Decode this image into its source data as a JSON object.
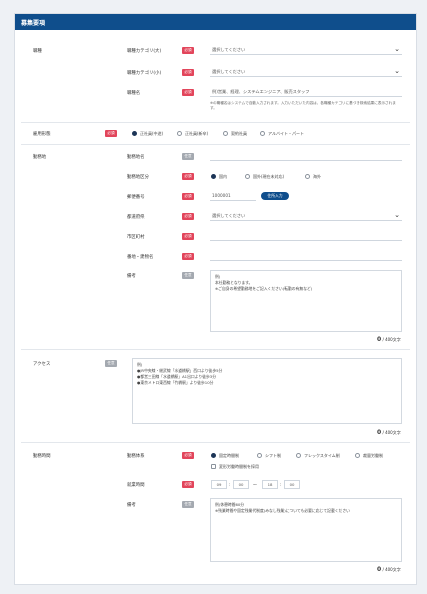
{
  "header": {
    "title": "募集要項"
  },
  "badges": {
    "required": "必須",
    "optional": "任意"
  },
  "occupation": {
    "label": "職種",
    "category_main_label": "職種カテゴリ(大)",
    "category_main_value": "選択してください",
    "category_sub_label": "職種カテゴリ(小)",
    "category_sub_value": "選択してください",
    "job_name_label": "職種名",
    "job_name_placeholder": "例)営業、経理、システムエンジニア、販売スタッフ",
    "note": "※の職種名はシステムで自動入力されます。入力いただいた内容は、各職種カテゴリに基づき検索結果に表示されます。"
  },
  "employment": {
    "label": "雇用形態",
    "options": [
      "正社員(中途)",
      "正社員(新卒)",
      "契約社員",
      "アルバイト・パート"
    ],
    "selected_index": 0
  },
  "workplace": {
    "label": "勤務地",
    "name_label": "勤務地名",
    "location_type_label": "勤務地区分",
    "location_type_options": [
      "国内",
      "国外(現在未対応)",
      "海外"
    ],
    "location_type_selected": 0,
    "postal_label": "郵便番号",
    "postal_value": "1000001",
    "postal_button": "住所入力",
    "prefecture_label": "都道府県",
    "prefecture_value": "選択してください",
    "city_label": "市区町村",
    "building_label": "番地・建物名",
    "remarks_label": "備考",
    "remarks_text": "例)\n本社勤務となります。\n※ご自身の希望勤務地をご記入ください(転勤の有無など)",
    "remarks_count": "0",
    "remarks_limit": "/ 400文字"
  },
  "appeal": {
    "label": "アクセス",
    "text": "例)\n●JR中央線・総武線「水道橋駅」西口より徒歩5分\n●都営三田線「水道橋駅」A1出口より徒歩3分\n●東京メトロ東西線「竹橋駅」より徒歩10分",
    "count": "0",
    "limit": "/ 400文字"
  },
  "hours": {
    "label": "勤務時間",
    "type_label": "勤務体系",
    "type_options": [
      "固定時間制",
      "シフト制",
      "フレックスタイム制",
      "裁量労働制"
    ],
    "type_selected": 0,
    "type_checkbox": "変形労働時間制を採用",
    "time_label": "就業時間",
    "time_values": [
      "09",
      "00",
      "18",
      "00"
    ],
    "remarks_label": "備考",
    "remarks_text": "例)休憩時間60分\n※残業時間や固定残業代制度(みなし残業)についても必要に応じて記載ください",
    "remarks_count": "0",
    "remarks_limit": "/ 400文字"
  }
}
